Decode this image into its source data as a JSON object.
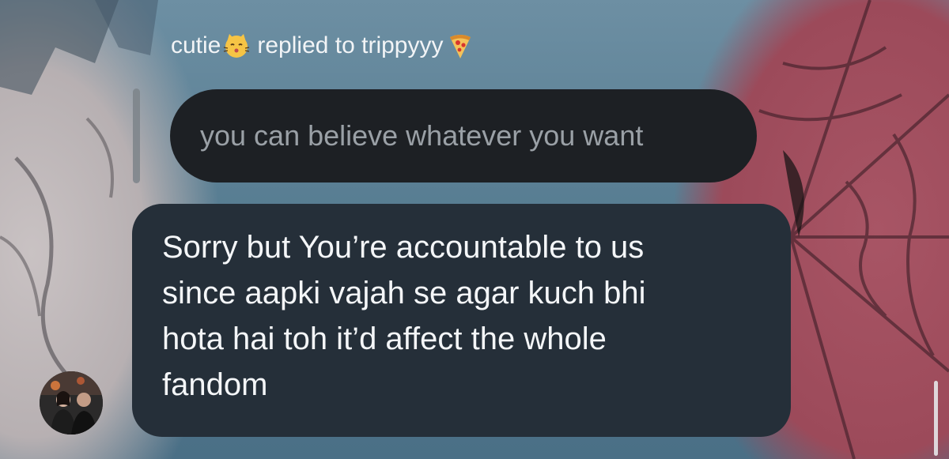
{
  "reply_header": {
    "sender": "cutie",
    "sender_emoji": "kissing-cat-emoji",
    "action_text": "replied to trippyyy",
    "recipient_emoji": "pizza-emoji"
  },
  "quoted_message": {
    "text": "you can believe whatever you want"
  },
  "message": {
    "lines": [
      "Sorry but You’re accountable to us",
      "since aapki vajah se agar kuch bhi",
      "hota hai toh it’d affect the whole",
      "fandom"
    ]
  },
  "avatar": {
    "icon": "profile-photo"
  },
  "colors": {
    "quoted_bubble": "#1d2024",
    "message_bubble": "#252f39",
    "quoted_text": "#9aa0a6",
    "message_text": "#f4f6f8"
  }
}
